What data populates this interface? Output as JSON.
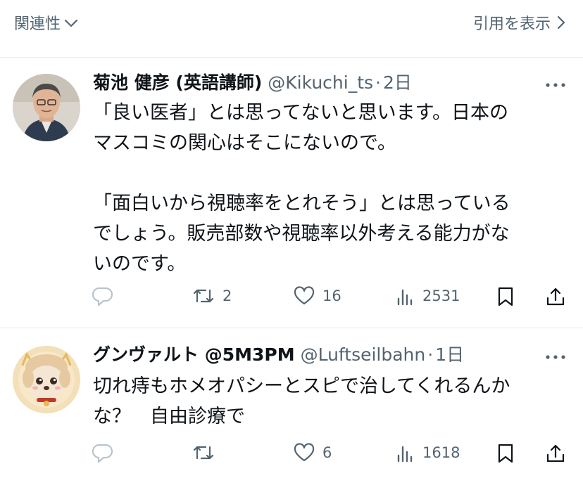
{
  "header": {
    "sort_label": "関連性",
    "quotes_label": "引用を表示"
  },
  "tweets": [
    {
      "display_name": "菊池 健彦 (英語講師)",
      "handle": "@Kikuchi_ts",
      "separator": "·",
      "time": "2日",
      "text": "「良い医者」とは思ってないと思います。日本の\nマスコミの関心はそこにないので。\n\n「面白いから視聴率をとれそう」とは思っている\nでしょう。販売部数や視聴率以外考える能力がな\nいのです。",
      "reply_count": "",
      "retweet_count": "2",
      "like_count": "16",
      "view_count": "2531"
    },
    {
      "display_name": "グンヴァルト @5M3PM",
      "handle": "@Luftseilbahn",
      "separator": "·",
      "time": "1日",
      "text": "切れ痔もホメオパシーとスピで治してくれるんか\nな？　自由診療で",
      "reply_count": "",
      "retweet_count": "",
      "like_count": "6",
      "view_count": "1618"
    }
  ],
  "icons": {
    "sort": "chevron-down-icon",
    "quotes": "chevron-right-icon",
    "more": "more-icon",
    "reply": "reply-icon",
    "retweet": "retweet-icon",
    "like": "heart-icon",
    "views": "views-icon",
    "bookmark": "bookmark-icon",
    "share": "share-icon"
  },
  "colors": {
    "text": "#0f1419",
    "secondary": "#536471",
    "divider": "#e6e9eb",
    "reply_icon": "#b9c4cc"
  }
}
